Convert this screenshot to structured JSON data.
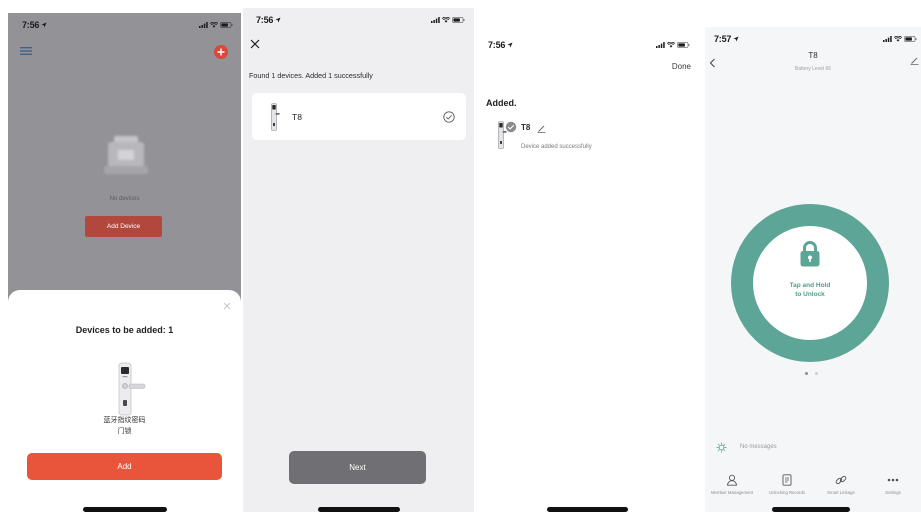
{
  "colors": {
    "overlay_grey": "#929297",
    "plus_red": "#d9483b",
    "add_device_red": "#b2483d",
    "add_red": "#e8553b",
    "next_grey": "#707074",
    "teal": "#5da597"
  },
  "screen1": {
    "status_time": "7:56",
    "empty_text": "No devices",
    "add_device_label": "Add Device",
    "sheet": {
      "title": "Devices to be added: 1",
      "device_name_line1": "蓝牙指纹密码",
      "device_name_line2": "门锁",
      "add_label": "Add"
    },
    "icons": [
      "location-arrow-icon",
      "signal-icon",
      "wifi-icon",
      "battery-icon",
      "device-list-icon",
      "plus-icon",
      "close-icon",
      "door-lock-image"
    ]
  },
  "screen2": {
    "status_time": "7:56",
    "found_text": "Found 1 devices. Added 1 successfully",
    "device_name": "T8",
    "next_label": "Next",
    "icons": [
      "close-icon",
      "door-lock-icon",
      "check-circle-icon"
    ]
  },
  "screen3": {
    "status_time": "7:56",
    "done_label": "Done",
    "heading": "Added.",
    "device_name": "T8",
    "status_text": "Device added successfully",
    "icons": [
      "door-lock-icon",
      "check-badge-icon",
      "pencil-icon"
    ]
  },
  "screen4": {
    "status_time": "7:57",
    "title": "T8",
    "subtitle": "Battery Level 66",
    "unlock_line1": "Tap and Hold",
    "unlock_line2": "to Unlock",
    "messages_text": "No messages",
    "carousel": {
      "current_page": 1,
      "page_count": 2
    },
    "tabs": [
      {
        "label": "Member Management",
        "icon": "person-icon"
      },
      {
        "label": "Unlocking Records",
        "icon": "document-icon"
      },
      {
        "label": "Smart Linkage",
        "icon": "link-icon"
      },
      {
        "label": "Settings",
        "icon": "more-dots-icon"
      }
    ],
    "icons": [
      "back-chevron-icon",
      "pencil-icon",
      "padlock-icon",
      "notification-icon"
    ]
  }
}
